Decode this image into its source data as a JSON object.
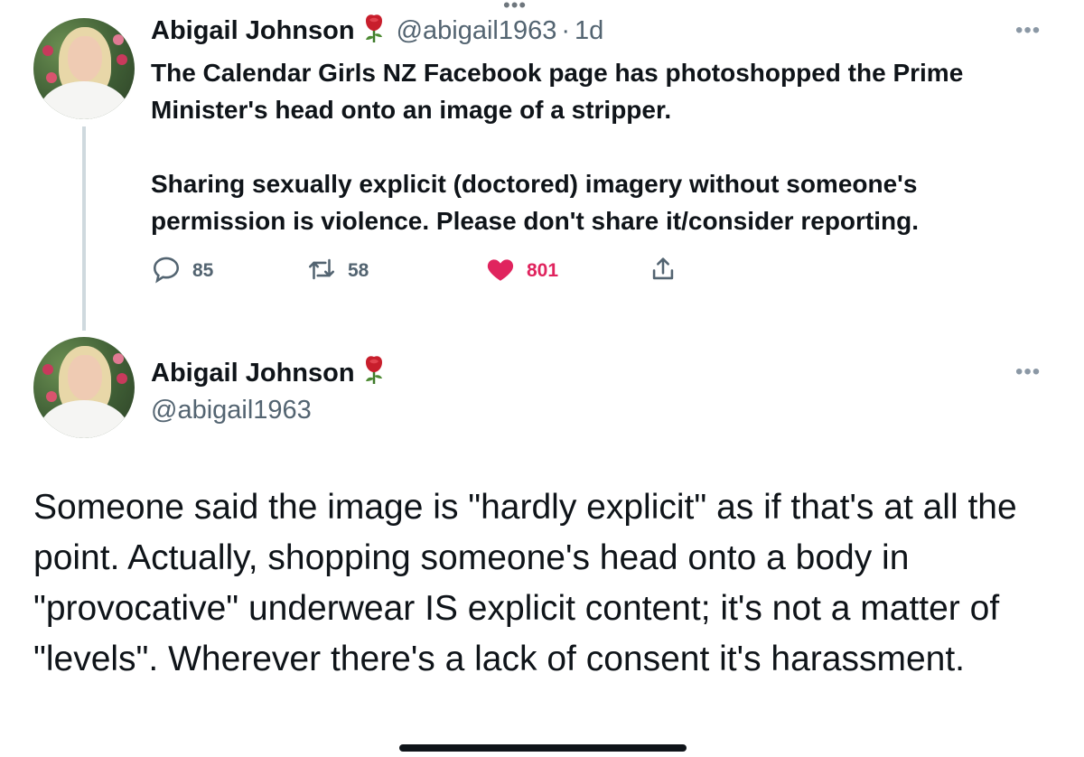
{
  "first_tweet": {
    "author_name": "Abigail Johnson",
    "author_handle": "@abigail1963",
    "separator": "·",
    "time": "1d",
    "paragraphs": [
      "The Calendar Girls NZ Facebook page has photoshopped the Prime Minister's head onto an image of a stripper.",
      "Sharing sexually explicit (doctored) imagery without someone's permission is violence. Please don't share it/consider reporting."
    ],
    "reply_count": "85",
    "retweet_count": "58",
    "like_count": "801"
  },
  "second_tweet": {
    "author_name": "Abigail Johnson",
    "author_handle": "@abigail1963",
    "text": "Someone said the image is \"hardly explicit\" as if that's at all the point. Actually, shopping someone's head onto a body in \"provocative\" underwear IS explicit content; it's not a matter of \"levels\". Wherever there's a lack of consent it's harassment."
  },
  "icons": {
    "top": "more-dots-icon",
    "badge": "rose-icon",
    "reply": "reply-icon",
    "retweet": "retweet-icon",
    "like": "heart-icon",
    "share": "share-icon"
  },
  "colors": {
    "like": "#e0245e",
    "secondary_text": "#536471",
    "thread_line": "#cfd9de",
    "rose": "#c81e2c"
  }
}
